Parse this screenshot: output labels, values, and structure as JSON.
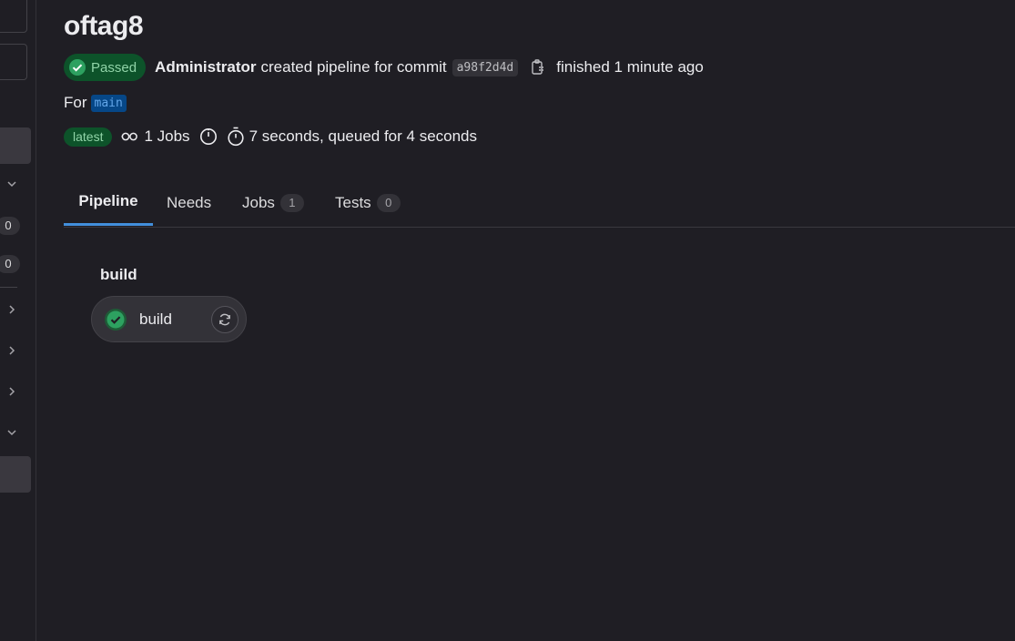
{
  "page": {
    "title": "oftag8"
  },
  "pipeline_header": {
    "status_label": "Passed",
    "author": "Administrator",
    "action_text": "created pipeline for commit",
    "commit_sha": "a98f2d4d",
    "finished_text": "finished 1 minute ago",
    "for_label": "For",
    "ref_name": "main",
    "latest_label": "latest",
    "jobs_text": "1 Jobs",
    "duration_text": "7 seconds, queued for 4 seconds"
  },
  "tabs": [
    {
      "label": "Pipeline",
      "count": null,
      "active": true
    },
    {
      "label": "Needs",
      "count": null,
      "active": false
    },
    {
      "label": "Jobs",
      "count": "1",
      "active": false
    },
    {
      "label": "Tests",
      "count": "0",
      "active": false
    }
  ],
  "graph": {
    "stage_name": "build",
    "jobs": [
      {
        "name": "build",
        "status": "success"
      }
    ]
  },
  "sidebar": {
    "counts": [
      "0",
      "0"
    ]
  },
  "colors": {
    "success": "#2da160",
    "link_blue": "#428fdc",
    "background": "#1f1e24"
  }
}
